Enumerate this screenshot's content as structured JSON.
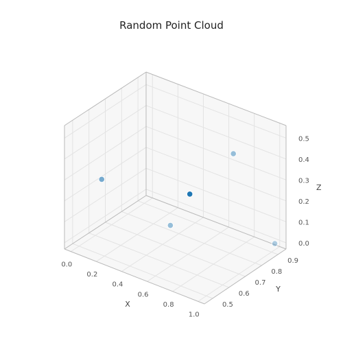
{
  "chart_data": {
    "type": "scatter",
    "title": "Random Point Cloud",
    "xlabel": "X",
    "ylabel": "Y",
    "zlabel": "Z",
    "x_ticks": [
      0.0,
      0.2,
      0.4,
      0.6,
      0.8,
      1.0
    ],
    "y_ticks": [
      0.5,
      0.6,
      0.7,
      0.8,
      0.9
    ],
    "z_ticks": [
      0.0,
      0.1,
      0.2,
      0.3,
      0.4,
      0.5
    ],
    "xlim": [
      -0.05,
      1.05
    ],
    "ylim": [
      0.45,
      0.95
    ],
    "zlim": [
      -0.03,
      0.56
    ],
    "points": [
      {
        "x": 0.05,
        "y": 0.6,
        "z": 0.25,
        "alpha": 0.6
      },
      {
        "x": 0.5,
        "y": 0.67,
        "z": 0.1,
        "alpha": 0.45
      },
      {
        "x": 0.55,
        "y": 0.75,
        "z": 0.22,
        "alpha": 1.0
      },
      {
        "x": 0.55,
        "y": 0.75,
        "z": 0.22,
        "alpha": 1.0
      },
      {
        "x": 0.7,
        "y": 0.9,
        "z": 0.37,
        "alpha": 0.45
      },
      {
        "x": 1.0,
        "y": 0.92,
        "z": 0.0,
        "alpha": 0.35
      }
    ],
    "marker_color": "#1f77b4",
    "marker_radius": 4.2
  }
}
